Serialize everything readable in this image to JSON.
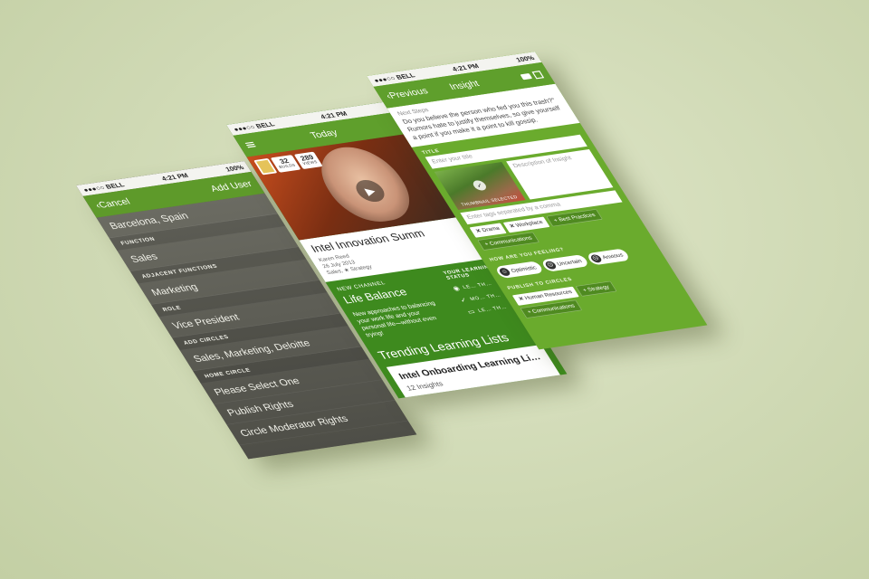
{
  "phones": {
    "add_user": {
      "status": {
        "carrier": "●●●○○ BELL",
        "time": "4:21 PM",
        "battery": "100%"
      },
      "nav": {
        "back": "‹Cancel",
        "title": "Add User"
      },
      "rows": [
        {
          "kind": "item",
          "text": "Barcelona, Spain"
        },
        {
          "kind": "section",
          "text": "FUNCTION"
        },
        {
          "kind": "item",
          "text": "Sales"
        },
        {
          "kind": "section",
          "text": "ADJACENT FUNCTIONS"
        },
        {
          "kind": "item",
          "text": "Marketing"
        },
        {
          "kind": "section",
          "text": "ROLE"
        },
        {
          "kind": "item",
          "text": "Vice President"
        },
        {
          "kind": "section",
          "text": "ADD CIRCLES"
        },
        {
          "kind": "item",
          "text": "Sales, Marketing, Deloitte"
        },
        {
          "kind": "section",
          "text": "HOME CIRCLE"
        },
        {
          "kind": "item",
          "text": "Please Select One"
        },
        {
          "kind": "item",
          "text": "Publish Rights"
        },
        {
          "kind": "item",
          "text": "Circle Moderator Rights"
        }
      ]
    },
    "today": {
      "status": {
        "carrier": "●●●○○ BELL",
        "time": "4:21 PM"
      },
      "nav": {
        "title": "Today"
      },
      "badges": {
        "builds_count": "32",
        "builds_label": "BUILDS",
        "views_count": "289",
        "views_label": "VIEWS"
      },
      "card": {
        "title": "Intel Innovation Summ",
        "author": "Karen Reed",
        "date": "26 July 2013",
        "tags": "Sales, ★ Strategy"
      },
      "channel": {
        "kicker": "NEW CHANNEL",
        "name": "Life Balance",
        "desc": "New approaches to balancing your work life and your personal life—without even trying!"
      },
      "status_panel": {
        "header": "YOUR LEARNING STATUS",
        "rows": [
          "LE… TH…",
          "MO… TH…",
          "LE… TH…"
        ]
      },
      "trending": {
        "title": "Trending Learning Lists",
        "list_title": "Intel Onboarding Learning Li…",
        "list_count": "12 Insights"
      }
    },
    "insight": {
      "status": {
        "carrier": "●●●○○ BELL",
        "time": "4:21 PM",
        "battery": "100%"
      },
      "nav": {
        "back": "‹Previous",
        "title": "Insight"
      },
      "top": {
        "label": "Next Steps",
        "text": "Do you believe the person who fed you this trash?\" Rumors hate to justify themselves, so give yourself a point if you make it a point to kill gossip."
      },
      "title_section": "TITLE",
      "title_placeholder": "Enter your title",
      "desc_placeholder": "Description of Insight",
      "thumb_caption": "THUMBNAIL SELECTED",
      "tags_placeholder": "Enter tags separated by a comma",
      "tags": [
        {
          "kind": "x",
          "text": "Drama"
        },
        {
          "kind": "x",
          "text": "Workplace"
        },
        {
          "kind": "add",
          "text": "Best Practices"
        },
        {
          "kind": "add",
          "text": "Communications"
        }
      ],
      "feel_section": "HOW ARE YOU FEELING?",
      "feelings": [
        {
          "icon": "☺",
          "text": "Optimistic"
        },
        {
          "icon": "☹",
          "text": "Uncertain"
        },
        {
          "icon": "☹",
          "text": "Anxious"
        }
      ],
      "publish_section": "PUBLISH TO CIRCLES",
      "circles": [
        {
          "kind": "x",
          "text": "Human Resources"
        },
        {
          "kind": "add",
          "text": "Strategy"
        },
        {
          "kind": "add",
          "text": "Communications"
        }
      ]
    }
  }
}
